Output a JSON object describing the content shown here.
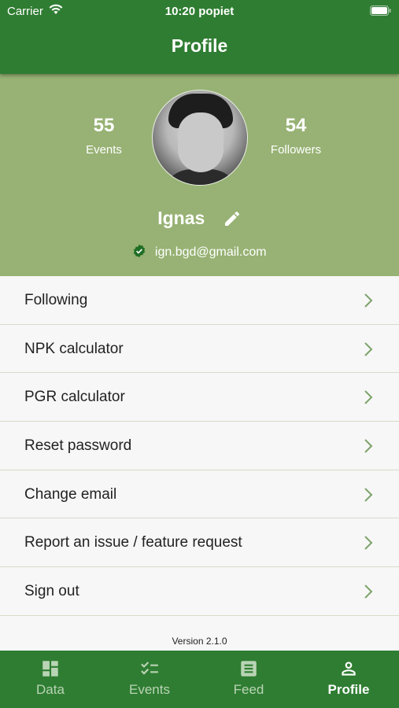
{
  "status_bar": {
    "carrier": "Carrier",
    "time": "10:20 popiet"
  },
  "header": {
    "title": "Profile"
  },
  "profile": {
    "events_count": "55",
    "events_label": "Events",
    "followers_count": "54",
    "followers_label": "Followers",
    "name": "Ignas",
    "email": "ign.bgd@gmail.com"
  },
  "menu": {
    "items": [
      {
        "label": "Following"
      },
      {
        "label": "NPK calculator"
      },
      {
        "label": "PGR calculator"
      },
      {
        "label": "Reset password"
      },
      {
        "label": "Change email"
      },
      {
        "label": "Report an issue / feature request"
      },
      {
        "label": "Sign out"
      }
    ]
  },
  "version": "Version 2.1.0",
  "tabbar": {
    "tabs": [
      {
        "label": "Data",
        "icon": "dashboard-icon"
      },
      {
        "label": "Events",
        "icon": "checklist-icon"
      },
      {
        "label": "Feed",
        "icon": "document-icon"
      },
      {
        "label": "Profile",
        "icon": "person-icon",
        "active": true
      }
    ]
  },
  "colors": {
    "primary": "#2f7d32",
    "summary_bg": "#97b274",
    "chevron": "#7ea36a"
  }
}
